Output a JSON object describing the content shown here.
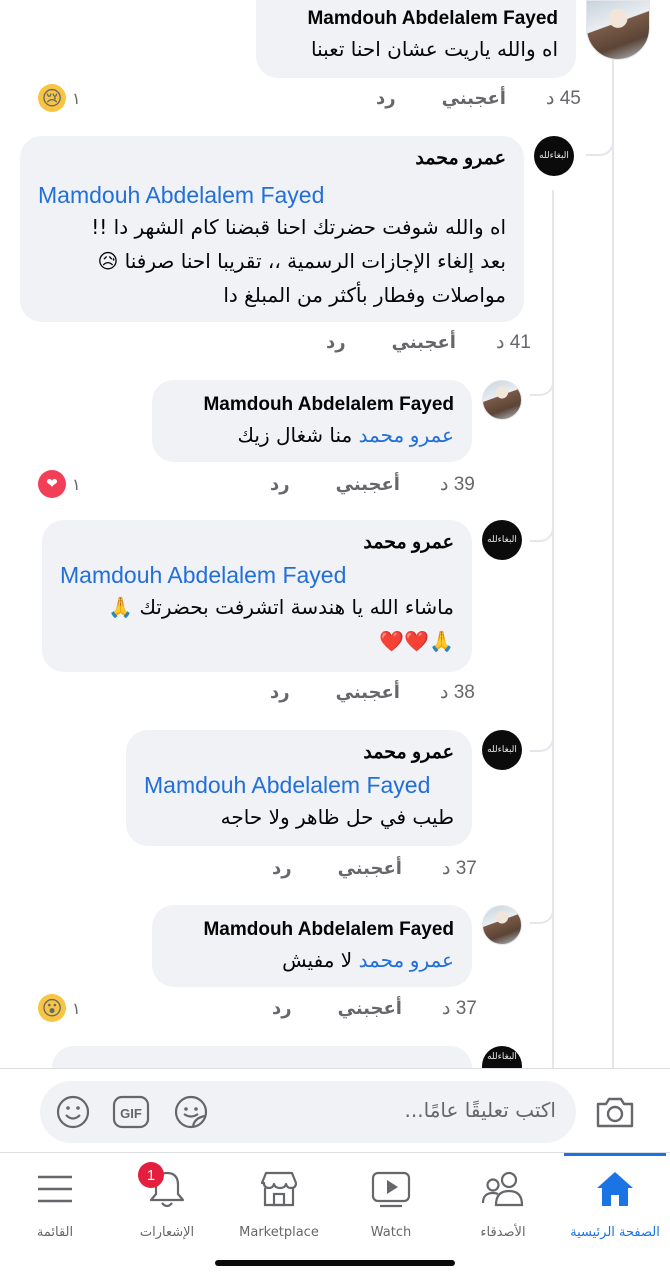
{
  "comments": [
    {
      "author": "Mamdouh Abdelalem Fayed",
      "text": "اه والله ياريت عشان احنا تعبنا",
      "time": "45 د",
      "like_label": "أعجبني",
      "reply_label": "رد",
      "reaction": {
        "icon": "crying-face",
        "emoji": "😢",
        "count": "١"
      }
    },
    {
      "author": "عمرو محمد",
      "mention": "Mamdouh Abdelalem Fayed",
      "lines": [
        "اه والله شوفت حضرتك احنا قبضنا كام الشهر دا  !!",
        "بعد إلغاء الإجازات الرسمية ،، تقريبا احنا صرفنا 😥",
        "مواصلات وفطار بأكثر من المبلغ دا"
      ],
      "time": "41 د",
      "like_label": "أعجبني",
      "reply_label": "رد"
    },
    {
      "author": "Mamdouh Abdelalem Fayed",
      "mention": "عمرو محمد",
      "text": "منا شغال زيك",
      "time": "39 د",
      "like_label": "أعجبني",
      "reply_label": "رد",
      "reaction": {
        "icon": "heart",
        "emoji": "❤",
        "count": "١"
      }
    },
    {
      "author": "عمرو محمد",
      "mention": "Mamdouh Abdelalem Fayed",
      "lines": [
        "ماشاء الله يا هندسة اتشرفت بحضرتك 🙏",
        "🙏❤️❤️"
      ],
      "time": "38 د",
      "like_label": "أعجبني",
      "reply_label": "رد"
    },
    {
      "author": "عمرو محمد",
      "mention": "Mamdouh Abdelalem Fayed",
      "text": "طيب في حل ظاهر ولا حاجه",
      "time": "37 د",
      "like_label": "أعجبني",
      "reply_label": "رد"
    },
    {
      "author": "Mamdouh Abdelalem Fayed",
      "mention": "عمرو محمد",
      "text": "لا مفيش",
      "time": "37 د",
      "like_label": "أعجبني",
      "reply_label": "رد",
      "reaction": {
        "icon": "wow-face",
        "emoji": "😮",
        "count": "١"
      }
    }
  ],
  "avatar_logo_text": "البغاءلله",
  "composer": {
    "placeholder": "اكتب تعليقًا عامًا...",
    "icons": [
      "camera-icon",
      "sticker-icon",
      "gif-icon",
      "emoji-icon"
    ],
    "gif_label": "GIF"
  },
  "tabbar": {
    "tabs": [
      {
        "id": "home",
        "label": "الصفحة الرئيسية",
        "icon": "home-icon",
        "active": true
      },
      {
        "id": "friends",
        "label": "الأصدقاء",
        "icon": "friends-icon"
      },
      {
        "id": "watch",
        "label": "Watch",
        "icon": "watch-icon"
      },
      {
        "id": "marketplace",
        "label": "Marketplace",
        "icon": "marketplace-icon"
      },
      {
        "id": "notifications",
        "label": "الإشعارات",
        "icon": "bell-icon",
        "badge": "1"
      },
      {
        "id": "menu",
        "label": "القائمة",
        "icon": "menu-icon"
      }
    ]
  },
  "colors": {
    "accent": "#1b74e4",
    "mention": "#216fdb",
    "bubble": "#f0f2f5",
    "badge": "#e41e3f",
    "meta_text": "#65676b"
  }
}
